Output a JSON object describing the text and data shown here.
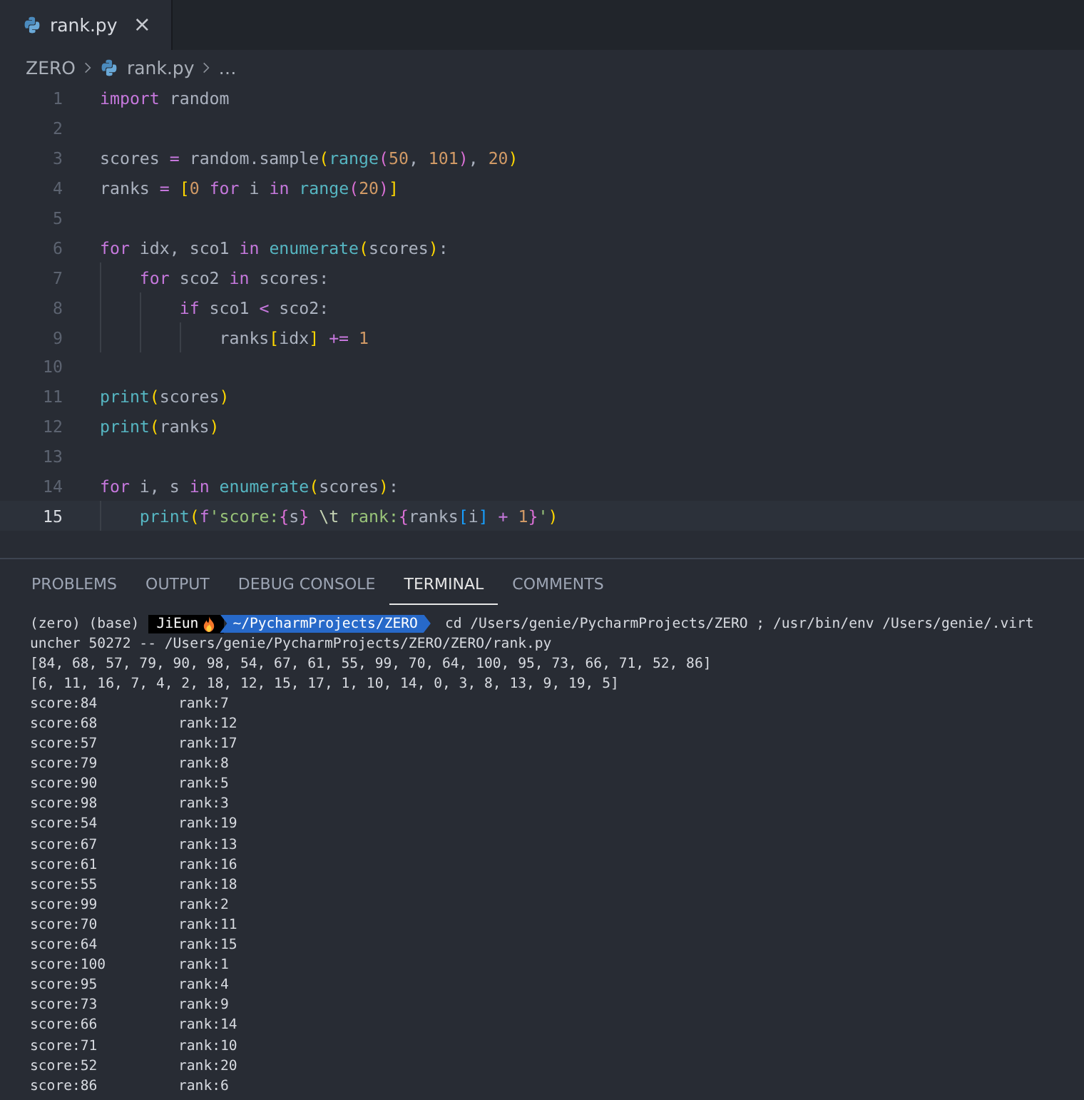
{
  "editor_tabs": [
    {
      "label": "rank.py",
      "selected": true,
      "close": "×"
    }
  ],
  "breadcrumb": {
    "folder": "ZERO",
    "file": "rank.py",
    "more": "…"
  },
  "code_lines": [
    {
      "number": "1",
      "current": false,
      "tokens": [
        {
          "t": "import",
          "kind": "keyword"
        },
        {
          "t": " random",
          "kind": "text"
        }
      ]
    },
    {
      "number": "2",
      "current": false
    },
    {
      "number": "3",
      "current": false,
      "tokens": [
        {
          "t": "scores ",
          "kind": "text"
        },
        {
          "t": "=",
          "kind": "op"
        },
        {
          "t": " random.sample",
          "kind": "text"
        },
        {
          "t": "(",
          "kind": "b1"
        },
        {
          "t": "range",
          "kind": "func"
        },
        {
          "t": "(",
          "kind": "b2"
        },
        {
          "t": "50",
          "kind": "num"
        },
        {
          "t": ", ",
          "kind": "text"
        },
        {
          "t": "101",
          "kind": "num"
        },
        {
          "t": ")",
          "kind": "b2"
        },
        {
          "t": ", ",
          "kind": "text"
        },
        {
          "t": "20",
          "kind": "num"
        },
        {
          "t": ")",
          "kind": "b1"
        }
      ]
    },
    {
      "number": "4",
      "current": false,
      "tokens": [
        {
          "t": "ranks ",
          "kind": "text"
        },
        {
          "t": "= ",
          "kind": "op"
        },
        {
          "t": "[",
          "kind": "b1"
        },
        {
          "t": "0 ",
          "kind": "num"
        },
        {
          "t": "for",
          "kind": "keyword"
        },
        {
          "t": " i ",
          "kind": "text"
        },
        {
          "t": "in ",
          "kind": "keyword"
        },
        {
          "t": "range",
          "kind": "func"
        },
        {
          "t": "(",
          "kind": "b2"
        },
        {
          "t": "20",
          "kind": "num"
        },
        {
          "t": ")",
          "kind": "b2"
        },
        {
          "t": "]",
          "kind": "b1"
        }
      ]
    },
    {
      "number": "5",
      "current": false
    },
    {
      "number": "6",
      "current": false,
      "tokens": [
        {
          "t": "for",
          "kind": "keyword"
        },
        {
          "t": " idx, sco1 ",
          "kind": "text"
        },
        {
          "t": "in ",
          "kind": "keyword"
        },
        {
          "t": "enumerate",
          "kind": "func"
        },
        {
          "t": "(",
          "kind": "b1"
        },
        {
          "t": "scores",
          "kind": "text"
        },
        {
          "t": ")",
          "kind": "b1"
        },
        {
          "t": ":",
          "kind": "text"
        }
      ]
    },
    {
      "number": "7",
      "current": false,
      "tokens": [
        {
          "t": "    for",
          "kind": "keyword"
        },
        {
          "t": " sco2 ",
          "kind": "text"
        },
        {
          "t": "in",
          "kind": "keyword"
        },
        {
          "t": " scores:",
          "kind": "text"
        }
      ]
    },
    {
      "number": "8",
      "current": false,
      "tokens": [
        {
          "t": "        if",
          "kind": "keyword"
        },
        {
          "t": " sco1 ",
          "kind": "text"
        },
        {
          "t": "<",
          "kind": "op"
        },
        {
          "t": " sco2:",
          "kind": "text"
        }
      ]
    },
    {
      "number": "9",
      "current": false,
      "tokens": [
        {
          "t": "            ranks",
          "kind": "text"
        },
        {
          "t": "[",
          "kind": "b1"
        },
        {
          "t": "idx",
          "kind": "text"
        },
        {
          "t": "] ",
          "kind": "b1"
        },
        {
          "t": "+= ",
          "kind": "op"
        },
        {
          "t": "1",
          "kind": "num"
        }
      ]
    },
    {
      "number": "10",
      "current": false
    },
    {
      "number": "11",
      "current": false,
      "tokens": [
        {
          "t": "print",
          "kind": "func"
        },
        {
          "t": "(",
          "kind": "b1"
        },
        {
          "t": "scores",
          "kind": "text"
        },
        {
          "t": ")",
          "kind": "b1"
        }
      ]
    },
    {
      "number": "12",
      "current": false,
      "tokens": [
        {
          "t": "print",
          "kind": "func"
        },
        {
          "t": "(",
          "kind": "b1"
        },
        {
          "t": "ranks",
          "kind": "text"
        },
        {
          "t": ")",
          "kind": "b1"
        }
      ]
    },
    {
      "number": "13",
      "current": false
    },
    {
      "number": "14",
      "current": false,
      "tokens": [
        {
          "t": "for",
          "kind": "keyword"
        },
        {
          "t": " i, s ",
          "kind": "text"
        },
        {
          "t": "in ",
          "kind": "keyword"
        },
        {
          "t": "enumerate",
          "kind": "func"
        },
        {
          "t": "(",
          "kind": "b1"
        },
        {
          "t": "scores",
          "kind": "text"
        },
        {
          "t": ")",
          "kind": "b1"
        },
        {
          "t": ":",
          "kind": "text"
        }
      ]
    },
    {
      "number": "15",
      "current": true,
      "tokens": [
        {
          "t": "    print",
          "kind": "func"
        },
        {
          "t": "(",
          "kind": "b1"
        },
        {
          "t": "f",
          "kind": "keyword"
        },
        {
          "t": "'score:",
          "kind": "string"
        },
        {
          "t": "{",
          "kind": "b2"
        },
        {
          "t": "s",
          "kind": "text"
        },
        {
          "t": "}",
          "kind": "b2"
        },
        {
          "t": " \\t",
          "kind": "escape"
        },
        {
          "t": " rank:",
          "kind": "string"
        },
        {
          "t": "{",
          "kind": "b2"
        },
        {
          "t": "ranks",
          "kind": "text"
        },
        {
          "t": "[",
          "kind": "b3"
        },
        {
          "t": "i",
          "kind": "text"
        },
        {
          "t": "] ",
          "kind": "b3"
        },
        {
          "t": "+ ",
          "kind": "op"
        },
        {
          "t": "1",
          "kind": "num"
        },
        {
          "t": "}",
          "kind": "b2"
        },
        {
          "t": "'",
          "kind": "string"
        },
        {
          "t": ")",
          "kind": "b1"
        }
      ]
    }
  ],
  "panel_tabs": [
    {
      "label": "PROBLEMS",
      "selected": false
    },
    {
      "label": "OUTPUT",
      "selected": false
    },
    {
      "label": "DEBUG CONSOLE",
      "selected": false
    },
    {
      "label": "TERMINAL",
      "selected": true
    },
    {
      "label": "COMMENTS",
      "selected": false
    }
  ],
  "terminal": {
    "env": "(zero) (base)",
    "user": "JiEun",
    "path": "~/PycharmProjects/ZERO",
    "command": "cd /Users/genie/PycharmProjects/ZERO ; /usr/bin/env /Users/genie/.virt",
    "output_lines": [
      "uncher 50272 -- /Users/genie/PycharmProjects/ZERO/ZERO/rank.py",
      "[84, 68, 57, 79, 90, 98, 54, 67, 61, 55, 99, 70, 64, 100, 95, 73, 66, 71, 52, 86]",
      "[6, 11, 16, 7, 4, 2, 18, 12, 15, 17, 1, 10, 14, 0, 3, 8, 13, 9, 19, 5]"
    ],
    "results": [
      {
        "score": "score:84",
        "rank": "rank:7"
      },
      {
        "score": "score:68",
        "rank": "rank:12"
      },
      {
        "score": "score:57",
        "rank": "rank:17"
      },
      {
        "score": "score:79",
        "rank": "rank:8"
      },
      {
        "score": "score:90",
        "rank": "rank:5"
      },
      {
        "score": "score:98",
        "rank": "rank:3"
      },
      {
        "score": "score:54",
        "rank": "rank:19"
      },
      {
        "score": "score:67",
        "rank": "rank:13"
      },
      {
        "score": "score:61",
        "rank": "rank:16"
      },
      {
        "score": "score:55",
        "rank": "rank:18"
      },
      {
        "score": "score:99",
        "rank": "rank:2"
      },
      {
        "score": "score:70",
        "rank": "rank:11"
      },
      {
        "score": "score:64",
        "rank": "rank:15"
      },
      {
        "score": "score:100",
        "rank": "rank:1"
      },
      {
        "score": "score:95",
        "rank": "rank:4"
      },
      {
        "score": "score:73",
        "rank": "rank:9"
      },
      {
        "score": "score:66",
        "rank": "rank:14"
      },
      {
        "score": "score:71",
        "rank": "rank:10"
      },
      {
        "score": "score:52",
        "rank": "rank:20"
      },
      {
        "score": "score:86",
        "rank": "rank:6"
      }
    ]
  }
}
